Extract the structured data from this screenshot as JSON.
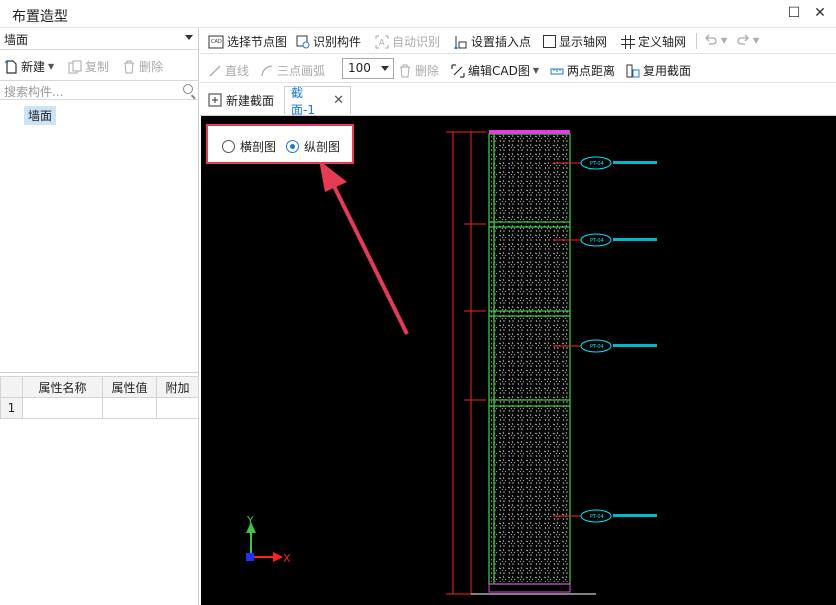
{
  "window": {
    "title": "布置造型",
    "maximize_glyph": "☐",
    "close_glyph": "✕"
  },
  "left": {
    "component_type": "墙面",
    "toolbar": {
      "new_label": "新建",
      "copy_label": "复制",
      "delete_label": "删除"
    },
    "search": {
      "placeholder": "搜索构件..."
    },
    "tree": {
      "selected": "墙面"
    },
    "props": {
      "headers": [
        "属性名称",
        "属性值",
        "附加"
      ],
      "rows": [
        {
          "index": "1",
          "name": "",
          "value": "",
          "extra": ""
        }
      ]
    }
  },
  "toolbar1": {
    "select_node": "选择节点图",
    "identify_component": "识别构件",
    "auto_identify": "自动识别",
    "set_insert_point": "设置插入点",
    "show_axis": "显示轴网",
    "define_axis": "定义轴网"
  },
  "toolbar2": {
    "line": "直线",
    "arc3": "三点画弧",
    "zoom": "100",
    "delete": "删除",
    "edit_cad": "编辑CAD图",
    "two_point_distance": "两点距离",
    "reuse_section": "复用截面"
  },
  "tabs": {
    "new_section": "新建截面",
    "section1": "截面-1"
  },
  "canvas": {
    "view_options": {
      "horizontal": "横剖图",
      "vertical": "纵剖图",
      "selected": "vertical"
    },
    "annotations": [
      "PT-04",
      "PT-04",
      "PT-04",
      "PT-04"
    ],
    "axis": {
      "y": "Y",
      "x": "X"
    }
  },
  "colors": {
    "accent": "#1a7ad8",
    "highlight": "#e63a55",
    "cad_green": "#3fc43f",
    "cad_cyan": "#00e5ff",
    "cad_red": "#ff2020"
  }
}
